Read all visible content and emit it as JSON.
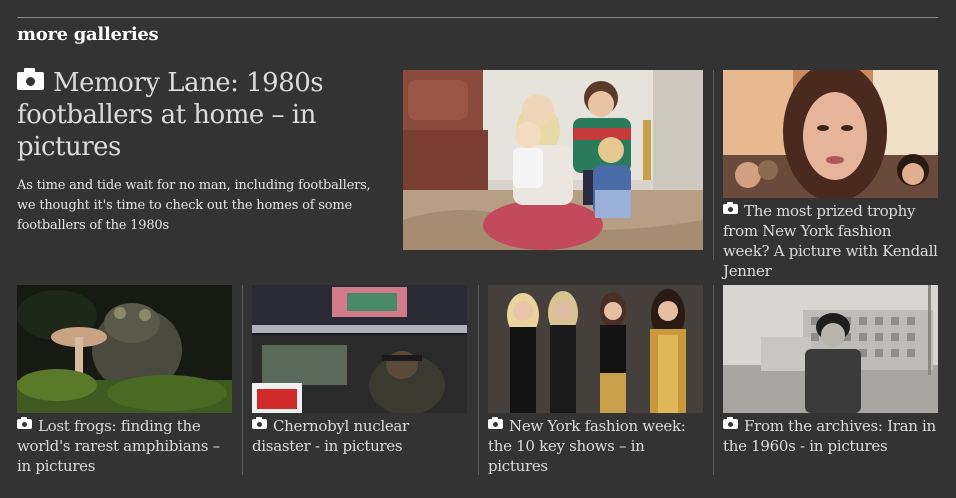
{
  "section": {
    "heading": "more galleries"
  },
  "feature": {
    "title": "Memory Lane: 1980s footballers at home – in pictures",
    "description": "As time and tide wait for no man, including footballers, we thought it's time to check out the homes of some footballers of the 1980s",
    "icon": "camera-icon"
  },
  "side": {
    "caption": "The most prized trophy from New York fashion week? A picture with Kendall Jenner",
    "icon": "camera-icon"
  },
  "cards": [
    {
      "caption": "Lost frogs: finding the world's rarest amphibians – in pictures",
      "icon": "camera-icon"
    },
    {
      "caption": "Chernobyl nuclear disaster - in pictures",
      "icon": "camera-icon"
    },
    {
      "caption": "New York fashion week: the 10 key shows – in pictures",
      "icon": "camera-icon"
    },
    {
      "caption": "From the archives: Iran in the 1960s - in pictures",
      "icon": "camera-icon"
    }
  ],
  "colors": {
    "background": "#333333",
    "text": "#dcdcdc",
    "heading": "#ffffff",
    "separator": "#5a5a5a"
  }
}
